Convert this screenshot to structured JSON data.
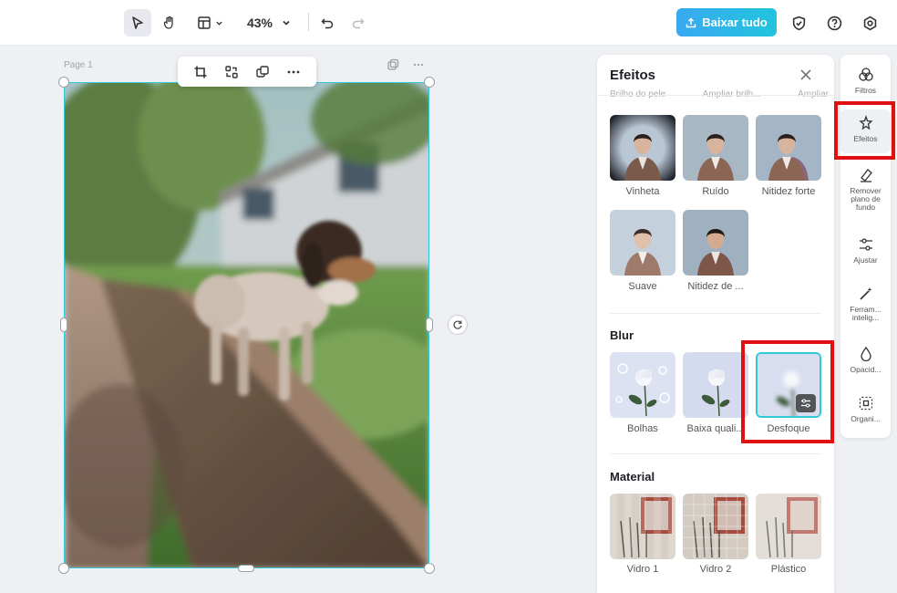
{
  "toolbar": {
    "zoom": "43%",
    "download_label": "Baixar tudo",
    "icons": [
      "pointer-icon",
      "hand-icon",
      "layout-icon",
      "undo-icon",
      "redo-icon",
      "shield-icon",
      "help-icon",
      "settings-icon"
    ]
  },
  "canvas": {
    "page_label": "Page 1"
  },
  "panel": {
    "title": "Efeitos",
    "cut_labels": [
      "Brilho do pele",
      "Ampliar brilh...",
      "Ampliar"
    ],
    "effects_row1": [
      "Vinheta",
      "Ruído",
      "Nitidez forte"
    ],
    "effects_row2": [
      "Suave",
      "Nitidez de ..."
    ],
    "blur_title": "Blur",
    "blur_items": [
      "Bolhas",
      "Baixa quali...",
      "Desfoque"
    ],
    "material_title": "Material",
    "material_items": [
      "Vidro 1",
      "Vidro 2",
      "Plástico"
    ]
  },
  "rail": {
    "items": [
      "Filtros",
      "Efeitos",
      "Remover plano de fundo",
      "Ajustar",
      "Ferram... intelig...",
      "Opacid...",
      "Organi..."
    ]
  },
  "colors": {
    "accent": "#22b8e6",
    "selection": "#30c9d6",
    "highlight": "#e01010"
  }
}
